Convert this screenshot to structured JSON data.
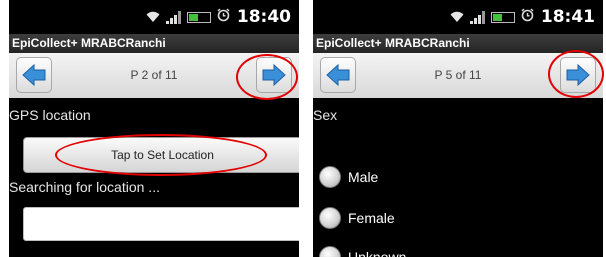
{
  "screens": [
    {
      "status_time": "18:40",
      "app_title": "EpiCollect+ MRABCRanchi",
      "page_indicator": "P 2 of 11",
      "field_label": "GPS location",
      "location_button_label": "Tap to Set Location",
      "status_message": "Searching for location ...",
      "location_input_value": ""
    },
    {
      "status_time": "18:41",
      "app_title": "EpiCollect+ MRABCRanchi",
      "page_indicator": "P 5 of 11",
      "field_label": "Sex",
      "options": [
        "Male",
        "Female",
        "Unknown"
      ]
    }
  ],
  "icons": {
    "prev": "arrow-left-icon",
    "next": "arrow-right-icon",
    "wifi": "wifi-icon",
    "signal": "signal-icon",
    "battery": "battery-icon",
    "alarm": "alarm-clock-icon"
  },
  "colors": {
    "highlight_ellipse": "#e30000",
    "arrow_blue": "#3a8fd9",
    "battery_green": "#44c040"
  }
}
